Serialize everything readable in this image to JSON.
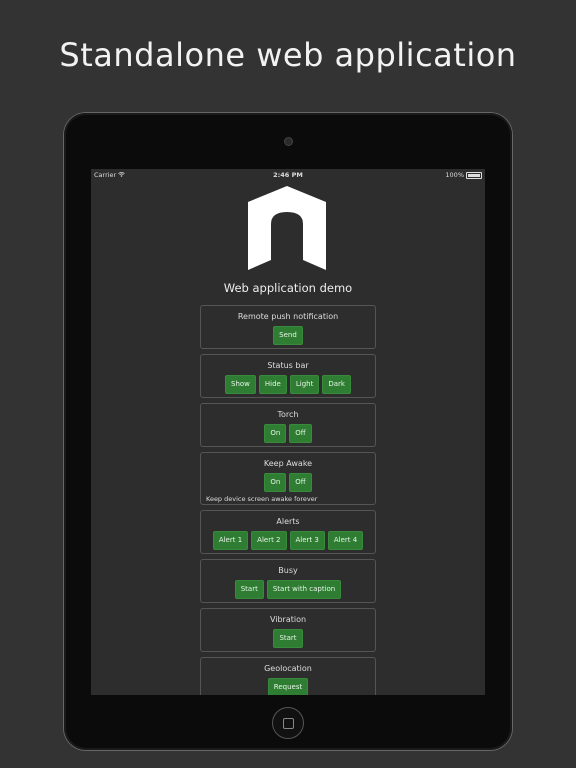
{
  "headline": "Standalone web application",
  "status_bar": {
    "carrier": "Carrier",
    "time": "2:46 PM",
    "battery": "100%"
  },
  "app": {
    "title": "Web application demo",
    "sections": {
      "push": {
        "title": "Remote push notification",
        "buttons": [
          "Send"
        ]
      },
      "statusbar": {
        "title": "Status bar",
        "buttons": [
          "Show",
          "Hide",
          "Light",
          "Dark"
        ]
      },
      "torch": {
        "title": "Torch",
        "buttons": [
          "On",
          "Off"
        ]
      },
      "awake": {
        "title": "Keep Awake",
        "buttons": [
          "On",
          "Off"
        ],
        "note": "Keep device screen awake forever"
      },
      "alerts": {
        "title": "Alerts",
        "buttons": [
          "Alert 1",
          "Alert 2",
          "Alert 3",
          "Alert 4"
        ]
      },
      "busy": {
        "title": "Busy",
        "buttons": [
          "Start",
          "Start with caption"
        ]
      },
      "vibration": {
        "title": "Vibration",
        "buttons": [
          "Start"
        ]
      },
      "geolocation": {
        "title": "Geolocation",
        "buttons": [
          "Request"
        ]
      }
    }
  },
  "colors": {
    "button_green": "#2e7d32",
    "background": "#333333",
    "screen": "#2d2d2d"
  }
}
